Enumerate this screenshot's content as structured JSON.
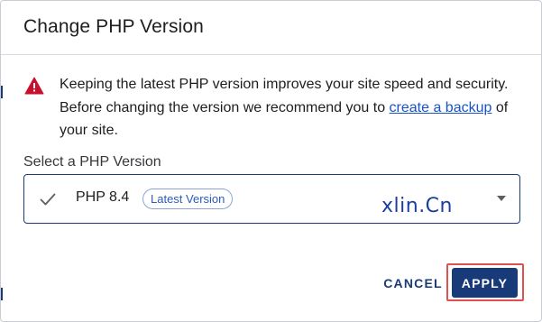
{
  "dialog": {
    "title": "Change PHP Version"
  },
  "warning": {
    "icon": "warning-triangle-icon",
    "icon_color": "#c8102e",
    "text_before_link": "Keeping the latest PHP version improves your site speed and security. Before changing the version we recommend you to ",
    "link_text": "create a backup",
    "text_after_link": " of your site."
  },
  "select": {
    "label": "Select a PHP Version",
    "selected_value": "PHP 8.4",
    "badge": "Latest Version",
    "watermark": "xlin.Cn",
    "check_icon": "check-icon",
    "caret_icon": "caret-down-icon"
  },
  "actions": {
    "cancel_label": "CANCEL",
    "apply_label": "APPLY"
  },
  "colors": {
    "primary": "#193a78",
    "link": "#1b52c8",
    "highlight": "#e0504f"
  }
}
